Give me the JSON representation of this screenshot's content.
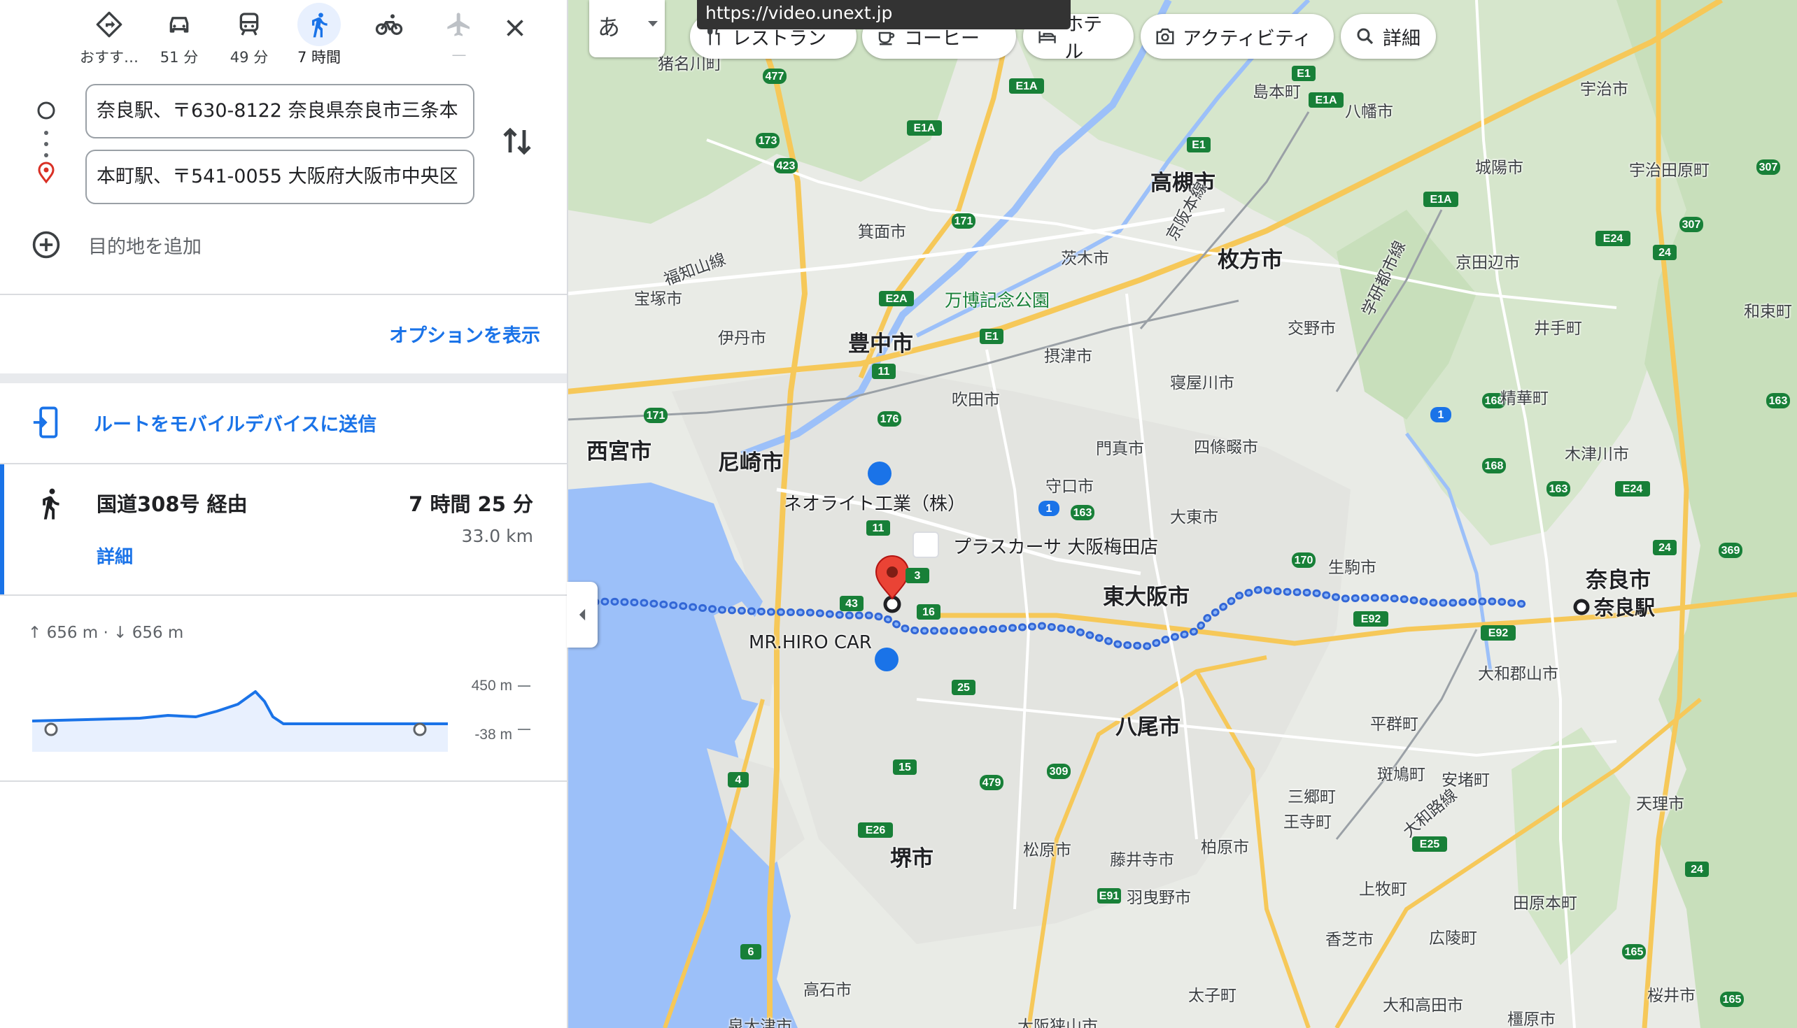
{
  "travel_modes": [
    {
      "name": "recommended",
      "label": "おすす…",
      "icon": "directions-icon",
      "active": false
    },
    {
      "name": "driving",
      "label": "51 分",
      "icon": "car-icon",
      "active": false
    },
    {
      "name": "transit",
      "label": "49 分",
      "icon": "train-icon",
      "active": false
    },
    {
      "name": "walking",
      "label": "7 時間",
      "icon": "walk-icon",
      "active": true
    },
    {
      "name": "cycling",
      "label": "",
      "icon": "bicycle-icon",
      "active": false
    },
    {
      "name": "flight",
      "label": "—",
      "icon": "airplane-icon",
      "active": false
    }
  ],
  "origin": {
    "value": "奈良駅、〒630-8122 奈良県奈良市三条本"
  },
  "destination": {
    "value": "本町駅、〒541-0055 大阪府大阪市中央区"
  },
  "add_destination_label": "目的地を追加",
  "options_label": "オプションを表示",
  "send_to_device_label": "ルートをモバイルデバイスに送信",
  "route": {
    "name": "国道308号 経由",
    "duration": "7 時間 25 分",
    "distance": "33.0 km",
    "details_label": "詳細"
  },
  "elevation": {
    "summary": "↑ 656 m · ↓ 656 m",
    "max_label": "450 m",
    "min_label": "-38 m"
  },
  "map": {
    "language_button": "あ",
    "tooltip": "https://video.unext.jp",
    "chips": [
      {
        "label": "レストラン",
        "icon": "restaurant-icon"
      },
      {
        "label": "コーヒー",
        "icon": "coffee-icon"
      },
      {
        "label": "ホテル",
        "icon": "hotel-icon"
      },
      {
        "label": "アクティビティ",
        "icon": "camera-icon"
      },
      {
        "label": "詳細",
        "icon": "search-icon"
      }
    ],
    "labels": {
      "nara_station": "奈良駅",
      "nara_city": "奈良市",
      "higashiosaka": "東大阪市",
      "yao": "八尾市",
      "sakai": "堺市",
      "toyonaka": "豊中市",
      "takatsuki": "高槻市",
      "hirakata": "枚方市",
      "nishinomiya": "西宮市",
      "amagasaki": "尼崎市",
      "neolite": "ネオライト工業（株）",
      "plascasa": "プラスカーサ 大阪梅田店",
      "mrhiro": "MR.HIRO CAR",
      "banpaku": "万博記念公園",
      "inagawa": "猪名川町",
      "takarazuka": "宝塚市",
      "itami": "伊丹市",
      "minoh": "箕面市",
      "ibaraki": "茨木市",
      "settsu": "摂津市",
      "suita": "吹田市",
      "neyagawa": "寝屋川市",
      "katano": "交野市",
      "kadoma": "門真市",
      "shijonawate": "四條畷市",
      "moriguchi": "守口市",
      "daito": "大東市",
      "ikoma": "生駒市",
      "shimamoto": "島本町",
      "yawata": "八幡市",
      "joyo": "城陽市",
      "uji": "宇治市",
      "ujitawara": "宇治田原町",
      "kyotanabe": "京田辺市",
      "ide": "井手町",
      "wazuka": "和束町",
      "seika": "精華町",
      "kizugawa": "木津川市",
      "yamatokoriyama": "大和郡山市",
      "heguri": "平群町",
      "ikaruga": "斑鳩町",
      "ando": "安堵町",
      "sango": "三郷町",
      "oji": "王寺町",
      "tenri": "天理市",
      "kashiba": "香芝市",
      "kanmaki": "上牧町",
      "koryo": "広陵町",
      "tawaramoto": "田原本町",
      "matsubara": "松原市",
      "fujiidera": "藤井寺市",
      "kashiwara": "柏原市",
      "habikino": "羽曳野市",
      "takaishi": "高石市",
      "taishi": "太子町",
      "yamatotakada": "大和高田市",
      "sakurai": "桜井市",
      "kashihara": "橿原市",
      "izumiotsu": "泉大津市",
      "osakasayama": "大阪狭山市",
      "fukuchiyama_line": "福知山線",
      "keihan_line": "京阪本線",
      "gakken_line": "学研都市線",
      "yamatoji_line": "大和路線"
    }
  }
}
